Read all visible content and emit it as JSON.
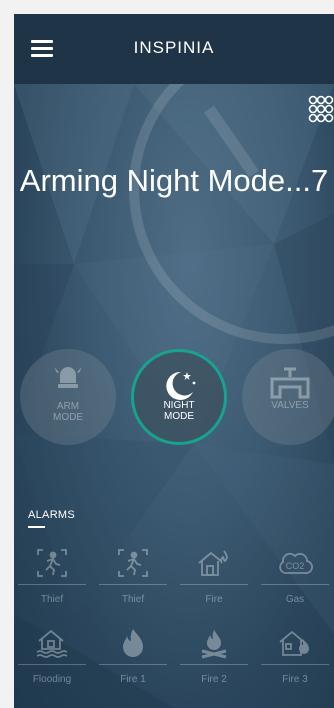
{
  "header": {
    "logo_text": "INSPINIA"
  },
  "status": {
    "title": "Arming Night Mode...7"
  },
  "modes": [
    {
      "label_line1": "ARM",
      "label_line2": "MODE",
      "active": false,
      "icon": "alarm-icon"
    },
    {
      "label_line1": "NIGHT",
      "label_line2": "MODE",
      "active": true,
      "icon": "moon-stars-icon"
    },
    {
      "label_line1": "VALVES",
      "label_line2": "",
      "active": false,
      "icon": "valve-icon"
    }
  ],
  "alarms": {
    "title": "ALARMS",
    "items": [
      {
        "label": "Thief",
        "icon": "running-person-icon"
      },
      {
        "label": "Thief",
        "icon": "running-person-icon"
      },
      {
        "label": "Fire",
        "icon": "house-fire-icon"
      },
      {
        "label": "Gas",
        "icon": "co2-cloud-icon"
      },
      {
        "label": "Flooding",
        "icon": "flooded-house-icon"
      },
      {
        "label": "Fire 1",
        "icon": "flame-icon"
      },
      {
        "label": "Fire 2",
        "icon": "campfire-icon"
      },
      {
        "label": "Fire 3",
        "icon": "burning-house-icon"
      }
    ]
  },
  "colors": {
    "accent": "#17a38e",
    "topbar": "#1f3447"
  }
}
